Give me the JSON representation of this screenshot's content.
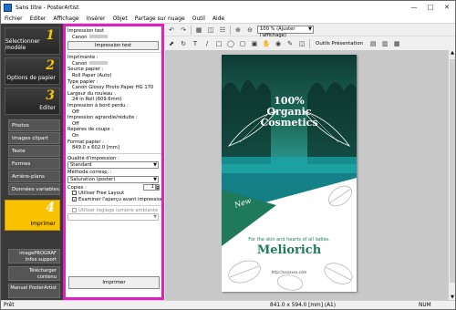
{
  "window": {
    "title": "Sans titre - PosterArtist"
  },
  "menu": [
    "Fichier",
    "Editer",
    "Affichage",
    "Insérer",
    "Objet",
    "Partage sur nuage",
    "Outil",
    "Aide"
  ],
  "steps": [
    {
      "num": "1",
      "label": "Sélectionner modèle"
    },
    {
      "num": "2",
      "label": "Options de papier"
    },
    {
      "num": "3",
      "label": "Editer"
    },
    {
      "num": "4",
      "label": "Imprimer"
    }
  ],
  "edit_items": [
    "Photos",
    "Images clipart",
    "Texte",
    "Formes",
    "Arrière-plans",
    "Données variables"
  ],
  "side_buttons": [
    "imagePROGRAF Infos support",
    "Télécharger contenu",
    "Manuel PosterArtist"
  ],
  "panel": {
    "test_heading": "Impression test",
    "test_printer": "Canon",
    "test_button": "Impression test",
    "printer_label": "Imprimante :",
    "printer_value": "Canon",
    "source_label": "Source papier :",
    "source_value": "Roll Paper (Auto)",
    "type_label": "Type papier :",
    "type_value": "Canon Glossy Photo Paper HG 170",
    "width_label": "Largeur du rouleau :",
    "width_value": "24 in Roll (609.6mm)",
    "borderless_label": "Impression à bord perdu :",
    "borderless_value": "Off",
    "enlarge_label": "Impression agrandie/réduite :",
    "enlarge_value": "Off",
    "crop_label": "Repères de coupe :",
    "crop_value": "On",
    "format_label": "Format papier :",
    "format_value": "849.0 x 602.0 [mm]",
    "quality_label": "Qualité d'impression :",
    "quality_value": "Standard",
    "matching_label": "Méthode corresp. :",
    "matching_value": "Saturation (poster)",
    "copies_label": "Copies :",
    "copies_value": "1",
    "free_layout": "Utiliser Free Layout",
    "preview": "Examiner l'aperçu avant impression",
    "ambient": "Utiliser réglage lumière ambiante",
    "print_button": "Imprimer"
  },
  "toolbar": {
    "zoom": "100 % (Ajuster l'affichage)",
    "presentation": "Outils Présentation"
  },
  "poster": {
    "percent": "100%",
    "line1": "Organic",
    "line2": "Cosmetics",
    "badge": "New",
    "tagline": "For the skin and hearts of all ladies.",
    "brand": "Meliorich",
    "url": "http://xxxxxxx.com"
  },
  "status": {
    "left": "Prêt",
    "size": "841.0 x 594.0 [mm] (A1)",
    "right": "NUM"
  },
  "colors": {
    "highlight": "#e020c0",
    "active_step": "#f8c200",
    "poster_green": "#1f7a5c"
  }
}
